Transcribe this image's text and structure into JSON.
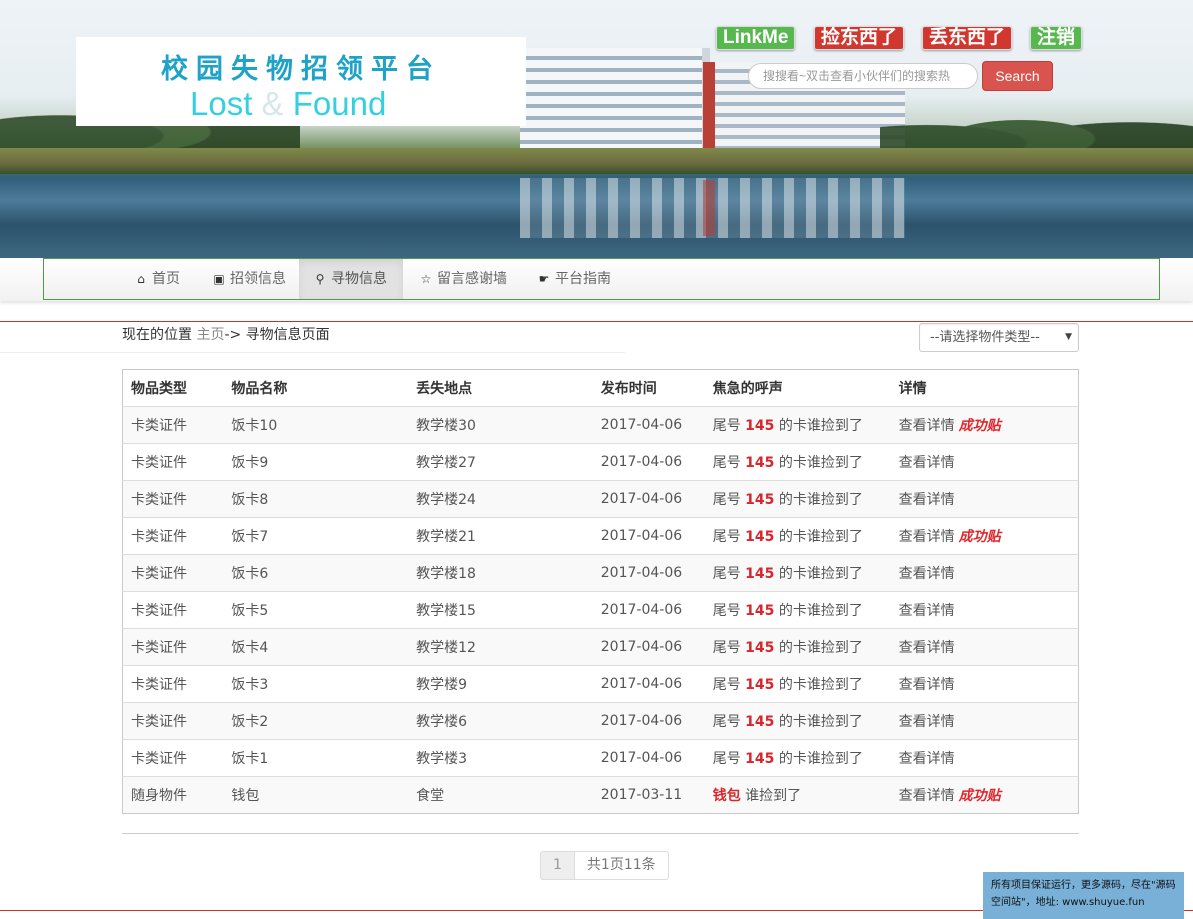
{
  "header": {
    "logo_cn": "校园失物招领平台",
    "logo_en_lost": "Lost",
    "logo_en_amp": "&",
    "logo_en_found": "Found",
    "links": {
      "linkme": "LinkMe",
      "found_item": "捡东西了",
      "lost_item": "丢东西了",
      "logout": "注销"
    },
    "search_placeholder": "搜搜看~双击查看小伙伴们的搜索热",
    "search_button": "Search"
  },
  "nav": {
    "items": [
      {
        "label": "首页",
        "icon": "home-icon"
      },
      {
        "label": "招领信息",
        "icon": "picture-icon"
      },
      {
        "label": "寻物信息",
        "icon": "zoom-in-icon"
      },
      {
        "label": "留言感谢墙",
        "icon": "star-icon"
      },
      {
        "label": "平台指南",
        "icon": "thumbs-up-icon"
      }
    ],
    "active_index": 2
  },
  "breadcrumb": {
    "prefix": "现在的位置",
    "home": "主页",
    "rest": "-> 寻物信息页面"
  },
  "filter": {
    "selected": "--请选择物件类型--"
  },
  "table": {
    "headers": [
      "物品类型",
      "物品名称",
      "丢失地点",
      "发布时间",
      "焦急的呼声",
      "详情"
    ],
    "rows": [
      {
        "type": "卡类证件",
        "name": "饭卡10",
        "place": "教学楼30",
        "date": "2017-04-06",
        "cry_pre": "尾号",
        "cry_num": "145",
        "cry_post": "的卡谁捡到了",
        "detail": "查看详情",
        "success": "成功贴"
      },
      {
        "type": "卡类证件",
        "name": "饭卡9",
        "place": "教学楼27",
        "date": "2017-04-06",
        "cry_pre": "尾号",
        "cry_num": "145",
        "cry_post": "的卡谁捡到了",
        "detail": "查看详情",
        "success": ""
      },
      {
        "type": "卡类证件",
        "name": "饭卡8",
        "place": "教学楼24",
        "date": "2017-04-06",
        "cry_pre": "尾号",
        "cry_num": "145",
        "cry_post": "的卡谁捡到了",
        "detail": "查看详情",
        "success": ""
      },
      {
        "type": "卡类证件",
        "name": "饭卡7",
        "place": "教学楼21",
        "date": "2017-04-06",
        "cry_pre": "尾号",
        "cry_num": "145",
        "cry_post": "的卡谁捡到了",
        "detail": "查看详情",
        "success": "成功贴"
      },
      {
        "type": "卡类证件",
        "name": "饭卡6",
        "place": "教学楼18",
        "date": "2017-04-06",
        "cry_pre": "尾号",
        "cry_num": "145",
        "cry_post": "的卡谁捡到了",
        "detail": "查看详情",
        "success": ""
      },
      {
        "type": "卡类证件",
        "name": "饭卡5",
        "place": "教学楼15",
        "date": "2017-04-06",
        "cry_pre": "尾号",
        "cry_num": "145",
        "cry_post": "的卡谁捡到了",
        "detail": "查看详情",
        "success": ""
      },
      {
        "type": "卡类证件",
        "name": "饭卡4",
        "place": "教学楼12",
        "date": "2017-04-06",
        "cry_pre": "尾号",
        "cry_num": "145",
        "cry_post": "的卡谁捡到了",
        "detail": "查看详情",
        "success": ""
      },
      {
        "type": "卡类证件",
        "name": "饭卡3",
        "place": "教学楼9",
        "date": "2017-04-06",
        "cry_pre": "尾号",
        "cry_num": "145",
        "cry_post": "的卡谁捡到了",
        "detail": "查看详情",
        "success": ""
      },
      {
        "type": "卡类证件",
        "name": "饭卡2",
        "place": "教学楼6",
        "date": "2017-04-06",
        "cry_pre": "尾号",
        "cry_num": "145",
        "cry_post": "的卡谁捡到了",
        "detail": "查看详情",
        "success": ""
      },
      {
        "type": "卡类证件",
        "name": "饭卡1",
        "place": "教学楼3",
        "date": "2017-04-06",
        "cry_pre": "尾号",
        "cry_num": "145",
        "cry_post": "的卡谁捡到了",
        "detail": "查看详情",
        "success": ""
      },
      {
        "type": "随身物件",
        "name": "钱包",
        "place": "食堂",
        "date": "2017-03-11",
        "cry_pre": "",
        "cry_num": "钱包",
        "cry_post": "谁捡到了",
        "detail": "查看详情",
        "success": "成功贴"
      }
    ]
  },
  "pagination": {
    "current": "1",
    "summary": "共1页11条"
  },
  "footer_note": {
    "line1": "所有项目保证运行，更多源码，尽在\"源码",
    "line2": "空间站\"，地址: www.shuyue.fun"
  },
  "colors": {
    "nav_border": "#4b9e44",
    "accent_red": "#d7262c",
    "search_button": "#d9534f",
    "tag_green": "#56b84e",
    "tag_red": "#d1372e",
    "footer_note_bg": "#78b0d8"
  }
}
